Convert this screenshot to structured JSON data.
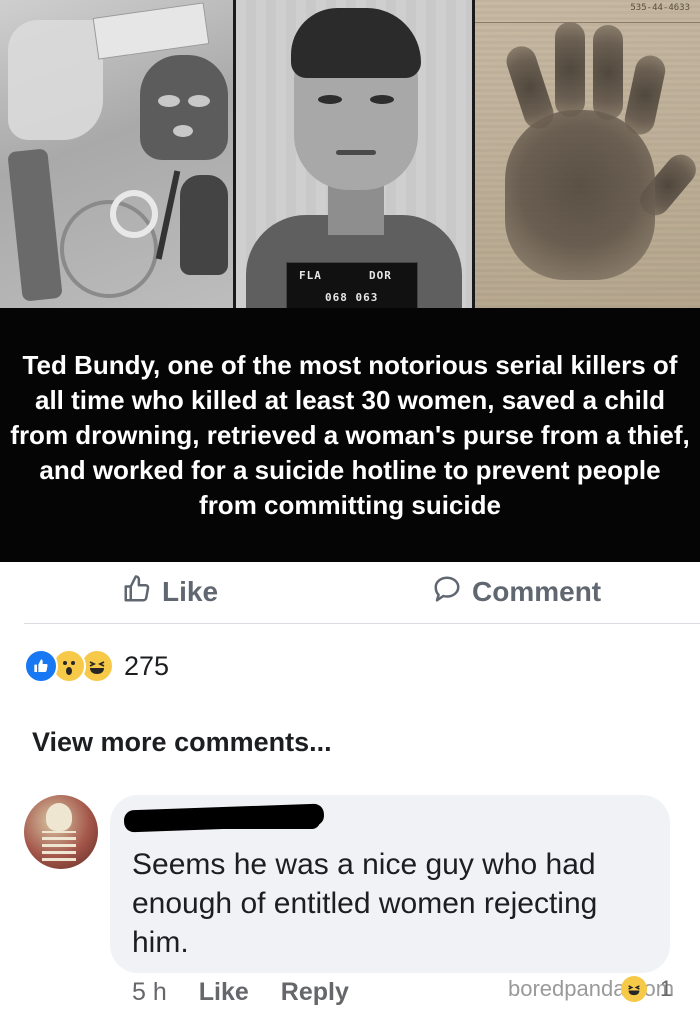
{
  "photos": {
    "mugshot_plate": [
      "FLA",
      "DOR",
      "068 063"
    ]
  },
  "post": {
    "caption": "Ted Bundy, one of the most notorious serial killers of all time who killed at least 30 women, saved a child from drowning, retrieved a woman's purse from a thief, and worked for a suicide hotline to prevent people from committing suicide"
  },
  "actions": {
    "like_label": "Like",
    "comment_label": "Comment"
  },
  "reactions": {
    "icons": [
      "like-icon",
      "wow-icon",
      "haha-icon"
    ],
    "count": "275"
  },
  "comments": {
    "view_more": "View more comments...",
    "items": [
      {
        "text": "Seems he was a nice guy who had enough of entitled women rejecting him.",
        "time": "5 h",
        "like_label": "Like",
        "reply_label": "Reply"
      }
    ]
  },
  "watermark": {
    "text_left": "boredpanda",
    "text_right": "om"
  },
  "reply_count": "1",
  "colors": {
    "caption_bg": "#050505",
    "fb_blue": "#1877f2",
    "meta_gray": "#65676b",
    "bubble_bg": "#f0f2f5"
  }
}
